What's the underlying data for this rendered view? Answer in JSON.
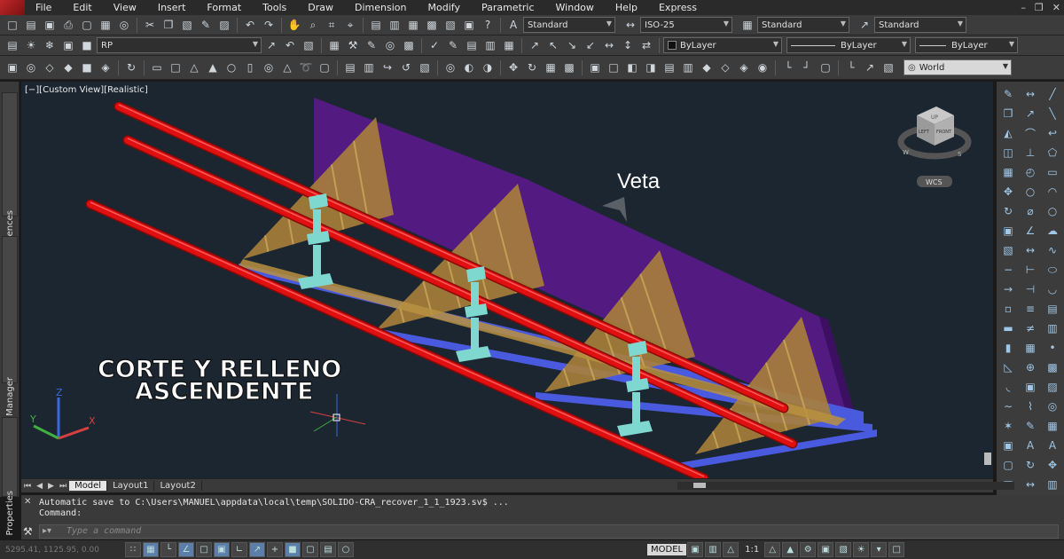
{
  "menubar": {
    "items": [
      "File",
      "Edit",
      "View",
      "Insert",
      "Format",
      "Tools",
      "Draw",
      "Dimension",
      "Modify",
      "Parametric",
      "Window",
      "Help",
      "Express"
    ]
  },
  "toolbar1": {
    "text_style": "Standard",
    "dim_style": "ISO-25",
    "table_style": "Standard",
    "multileader_style": "Standard"
  },
  "toolbar2": {
    "layer": "RP",
    "color": "ByLayer",
    "linetype": "ByLayer",
    "lineweight": "ByLayer"
  },
  "toolbar3": {
    "ucs": "World"
  },
  "palettes": [
    "External References",
    "Layer Properties Manager",
    "Properties"
  ],
  "viewport": {
    "label": "[−][Custom View][Realistic]",
    "annotation_veta": "Veta",
    "title_line1": "CORTE Y RELLENO",
    "title_line2": "ASCENDENTE",
    "viewcube_top": "UP",
    "viewcube_left": "LEFT",
    "viewcube_front": "FRONT",
    "wcs_label": "WCS",
    "compass_w": "W",
    "compass_s": "S",
    "axis_x": "X",
    "axis_y": "Y",
    "axis_z": "Z",
    "colors": {
      "background": "#1c2631",
      "pipe": "#e01010",
      "wall": "#5a1a8c",
      "fill": "#a8803a",
      "support": "#7fd8d0",
      "floor": "#4a5adf"
    }
  },
  "layout_tabs": {
    "tabs": [
      "Model",
      "Layout1",
      "Layout2"
    ],
    "active": "Model"
  },
  "command": {
    "history1": "Automatic save to C:\\Users\\MANUEL\\appdata\\local\\temp\\SOLIDO-CRA_recover_1_1_1923.sv$ ...",
    "history2": "Command:",
    "placeholder": "Type a command"
  },
  "statusbar": {
    "coords": "5295.41, 1125.95, 0.00",
    "model": "MODEL",
    "scale": "1:1"
  }
}
